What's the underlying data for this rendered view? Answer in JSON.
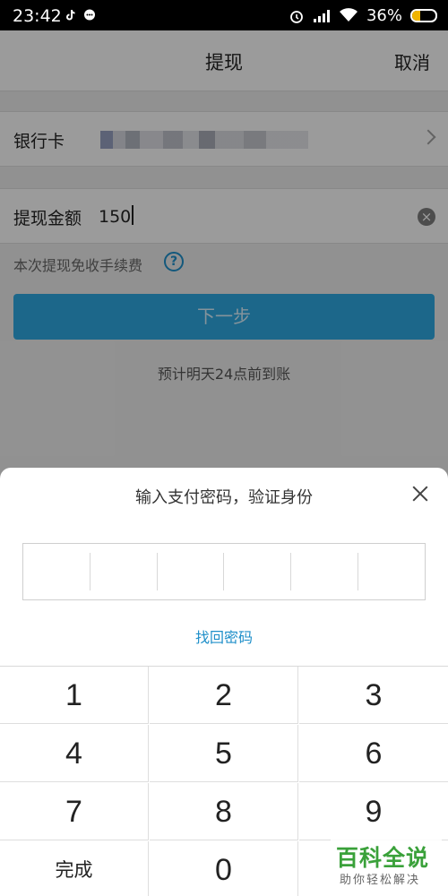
{
  "status_bar": {
    "time": "23:42",
    "battery": "36%",
    "battery_level": 0.36
  },
  "nav": {
    "title": "提现",
    "cancel": "取消"
  },
  "bank": {
    "label": "银行卡"
  },
  "amount": {
    "label": "提现金额",
    "value": "150"
  },
  "fee_note": "本次提现免收手续费",
  "next_button": "下一步",
  "eta_note": "预计明天24点前到账",
  "password_sheet": {
    "title": "输入支付密码，验证身份",
    "forgot": "找回密码",
    "digits_count": 6
  },
  "keypad": {
    "keys": [
      "1",
      "2",
      "3",
      "4",
      "5",
      "6",
      "7",
      "8",
      "9",
      "完成",
      "0",
      ""
    ]
  },
  "watermark": {
    "title": "百科全说",
    "subtitle": "助你轻松解决"
  },
  "colors": {
    "accent": "#2ea6df",
    "link": "#1f8fc9",
    "watermark": "#3aa13a"
  },
  "icons": [
    "tiktok-icon",
    "chat-icon",
    "alarm-icon",
    "signal-icon",
    "wifi-icon",
    "battery-icon",
    "chevron-right-icon",
    "clear-icon",
    "help-icon",
    "close-icon"
  ]
}
